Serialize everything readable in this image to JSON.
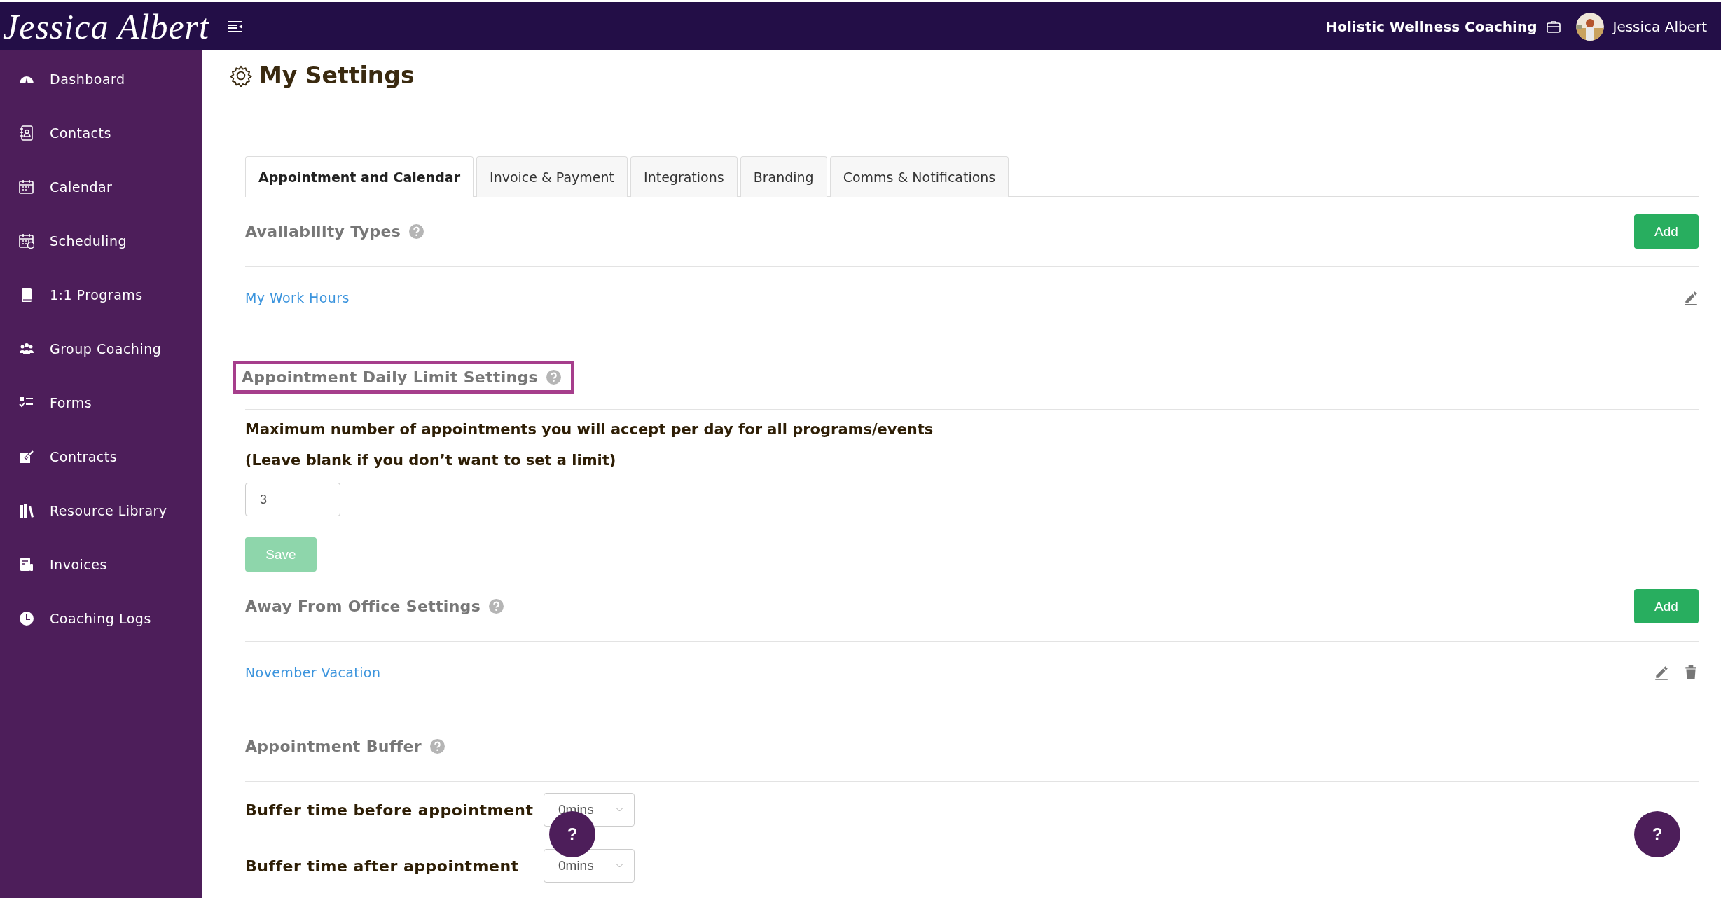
{
  "topbar": {
    "logo": "Jessica Albert",
    "business": "Holistic Wellness Coaching",
    "user": "Jessica Albert"
  },
  "sidebar": {
    "items": [
      {
        "label": "Dashboard"
      },
      {
        "label": "Contacts"
      },
      {
        "label": "Calendar"
      },
      {
        "label": "Scheduling"
      },
      {
        "label": "1:1 Programs"
      },
      {
        "label": "Group Coaching"
      },
      {
        "label": "Forms"
      },
      {
        "label": "Contracts"
      },
      {
        "label": "Resource Library"
      },
      {
        "label": "Invoices"
      },
      {
        "label": "Coaching Logs"
      }
    ]
  },
  "page": {
    "title": "My Settings"
  },
  "tabs": [
    {
      "label": "Appointment and Calendar",
      "selected": true
    },
    {
      "label": "Invoice & Payment",
      "selected": false
    },
    {
      "label": "Integrations",
      "selected": false
    },
    {
      "label": "Branding",
      "selected": false
    },
    {
      "label": "Comms & Notifications",
      "selected": false
    }
  ],
  "sections": [
    {
      "kind": "list",
      "title": "Availability Types",
      "highlighted": false,
      "add_button": "Add",
      "items": [
        {
          "label": "My Work Hours",
          "deletable": false
        }
      ]
    },
    {
      "kind": "limit",
      "title": "Appointment Daily Limit Settings",
      "highlighted": true,
      "lines": [
        "Maximum number of appointments you will accept per day for all programs/events",
        "(Leave blank if you don’t want to set a limit)"
      ],
      "value": "3",
      "save_button": "Save",
      "save_disabled": true
    },
    {
      "kind": "list",
      "title": "Away From Office Settings",
      "highlighted": false,
      "add_button": "Add",
      "items": [
        {
          "label": "November Vacation",
          "deletable": true
        }
      ]
    },
    {
      "kind": "buffer",
      "title": "Appointment Buffer",
      "highlighted": false,
      "rows": [
        {
          "label": "Buffer time before appointment",
          "value": "0mins"
        },
        {
          "label": "Buffer time after appointment",
          "value": "0mins"
        }
      ]
    }
  ],
  "help_buttons": [
    "?",
    "?"
  ]
}
